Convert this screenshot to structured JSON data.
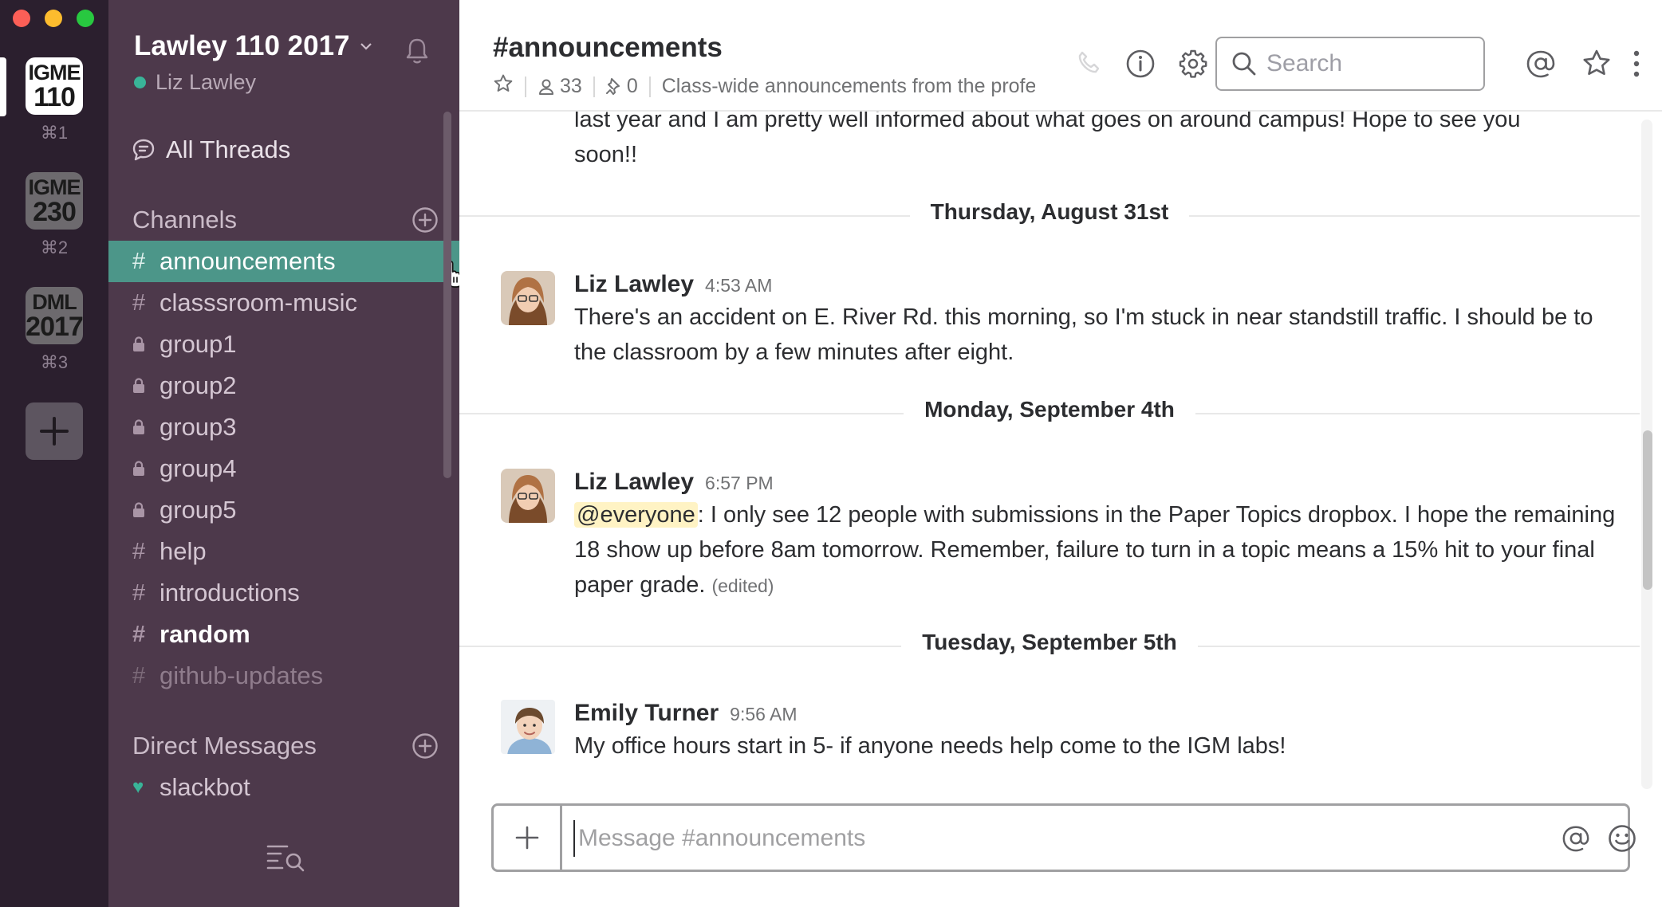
{
  "teams": [
    {
      "line1": "IGME",
      "line2": "110",
      "shortcut": "⌘1",
      "active": true
    },
    {
      "line1": "IGME",
      "line2": "230",
      "shortcut": "⌘2",
      "active": false
    },
    {
      "line1": "DML",
      "line2": "2017",
      "shortcut": "⌘3",
      "active": false
    }
  ],
  "workspace": {
    "name": "Lawley 110 2017",
    "user": "Liz Lawley"
  },
  "sidebar": {
    "all_threads": "All Threads",
    "channels_header": "Channels",
    "channels": [
      {
        "name": "announcements",
        "type": "public",
        "state": "active"
      },
      {
        "name": "classsroom-music",
        "type": "public",
        "state": "normal"
      },
      {
        "name": "group1",
        "type": "private",
        "state": "normal"
      },
      {
        "name": "group2",
        "type": "private",
        "state": "normal"
      },
      {
        "name": "group3",
        "type": "private",
        "state": "normal"
      },
      {
        "name": "group4",
        "type": "private",
        "state": "normal"
      },
      {
        "name": "group5",
        "type": "private",
        "state": "normal"
      },
      {
        "name": "help",
        "type": "public",
        "state": "normal"
      },
      {
        "name": "introductions",
        "type": "public",
        "state": "normal"
      },
      {
        "name": "random",
        "type": "public",
        "state": "unread"
      },
      {
        "name": "github-updates",
        "type": "public",
        "state": "muted"
      }
    ],
    "dm_header": "Direct Messages",
    "dms": [
      {
        "name": "slackbot"
      }
    ]
  },
  "header": {
    "channel": "#announcements",
    "members": "33",
    "pins": "0",
    "topic": "Class-wide announcements from the professor",
    "search_placeholder": "Search"
  },
  "messages": {
    "partial_text": "last year and I am pretty well informed about what goes on around campus! Hope to see you soon!!",
    "partial_line1": "last year and I am pretty well informed about what goes on around campus! Hope to see you",
    "partial_line2": "soon!!",
    "days": [
      {
        "label": "Thursday, August 31st"
      },
      {
        "label": "Monday, September 4th"
      },
      {
        "label": "Tuesday, September 5th"
      }
    ],
    "items": [
      {
        "author": "Liz Lawley",
        "time": "4:53 AM",
        "text": "There's an accident on E. River Rd. this morning, so I'm stuck in near standstill traffic. I should be to the classroom by a few minutes after eight."
      },
      {
        "author": "Liz Lawley",
        "time": "6:57 PM",
        "mention": "@everyone",
        "text": ": I only see 12 people with submissions in the Paper Topics dropbox. I hope the remaining 18 show up before 8am tomorrow. Remember, failure to turn in a topic means a 15% hit to your final paper grade.",
        "edited": "(edited)"
      },
      {
        "author": "Emily Turner",
        "time": "9:56 AM",
        "text": "My office hours start in 5- if anyone needs help come to the IGM labs!"
      }
    ]
  },
  "composer": {
    "placeholder": "Message #announcements"
  },
  "colors": {
    "sidebar": "#4d394b",
    "rail": "#2b1f2e",
    "active_channel": "#4c9689",
    "presence": "#39b498"
  }
}
